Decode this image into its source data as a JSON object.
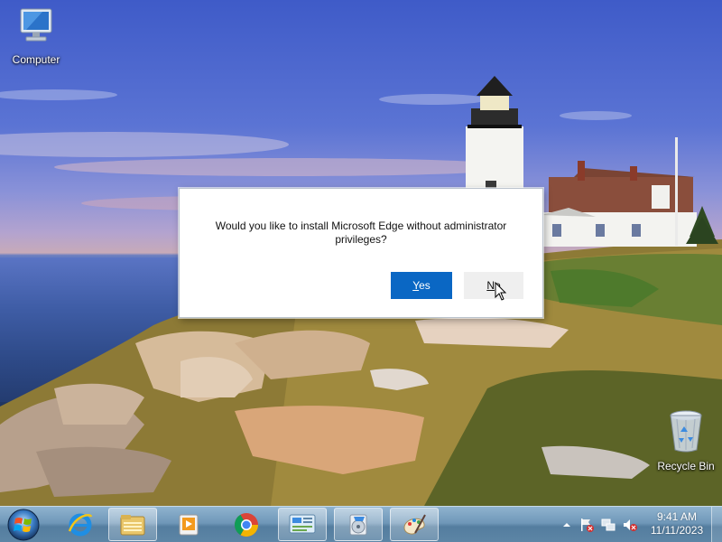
{
  "desktop": {
    "icons": [
      {
        "label": "Computer",
        "icon": "computer-icon"
      },
      {
        "label": "Recycle Bin",
        "icon": "recycle-bin-icon"
      }
    ]
  },
  "dialog": {
    "message": "Would you like to install Microsoft Edge without administrator privileges?",
    "yes_label": "Yes",
    "yes_access_key": "Y",
    "yes_rest": "es",
    "no_access_key": "N",
    "no_rest": "o",
    "colors": {
      "yes_bg": "#0a67c4",
      "no_bg": "#efefef"
    }
  },
  "taskbar": {
    "start": "windows-start-orb-icon",
    "pinned": [
      {
        "icon": "internet-explorer-icon"
      },
      {
        "icon": "file-explorer-icon",
        "active": true
      },
      {
        "icon": "media-player-icon"
      },
      {
        "icon": "chrome-icon"
      },
      {
        "icon": "control-panel-icon",
        "active": true
      },
      {
        "icon": "setup-installer-icon",
        "active": true
      },
      {
        "icon": "paint-icon",
        "active": true
      }
    ],
    "tray": {
      "icons": [
        "show-hidden-icons-chevron-icon",
        "action-center-flag-icon",
        "network-icon",
        "volume-muted-icon"
      ],
      "time": "9:41 AM",
      "date": "11/11/2023"
    }
  }
}
